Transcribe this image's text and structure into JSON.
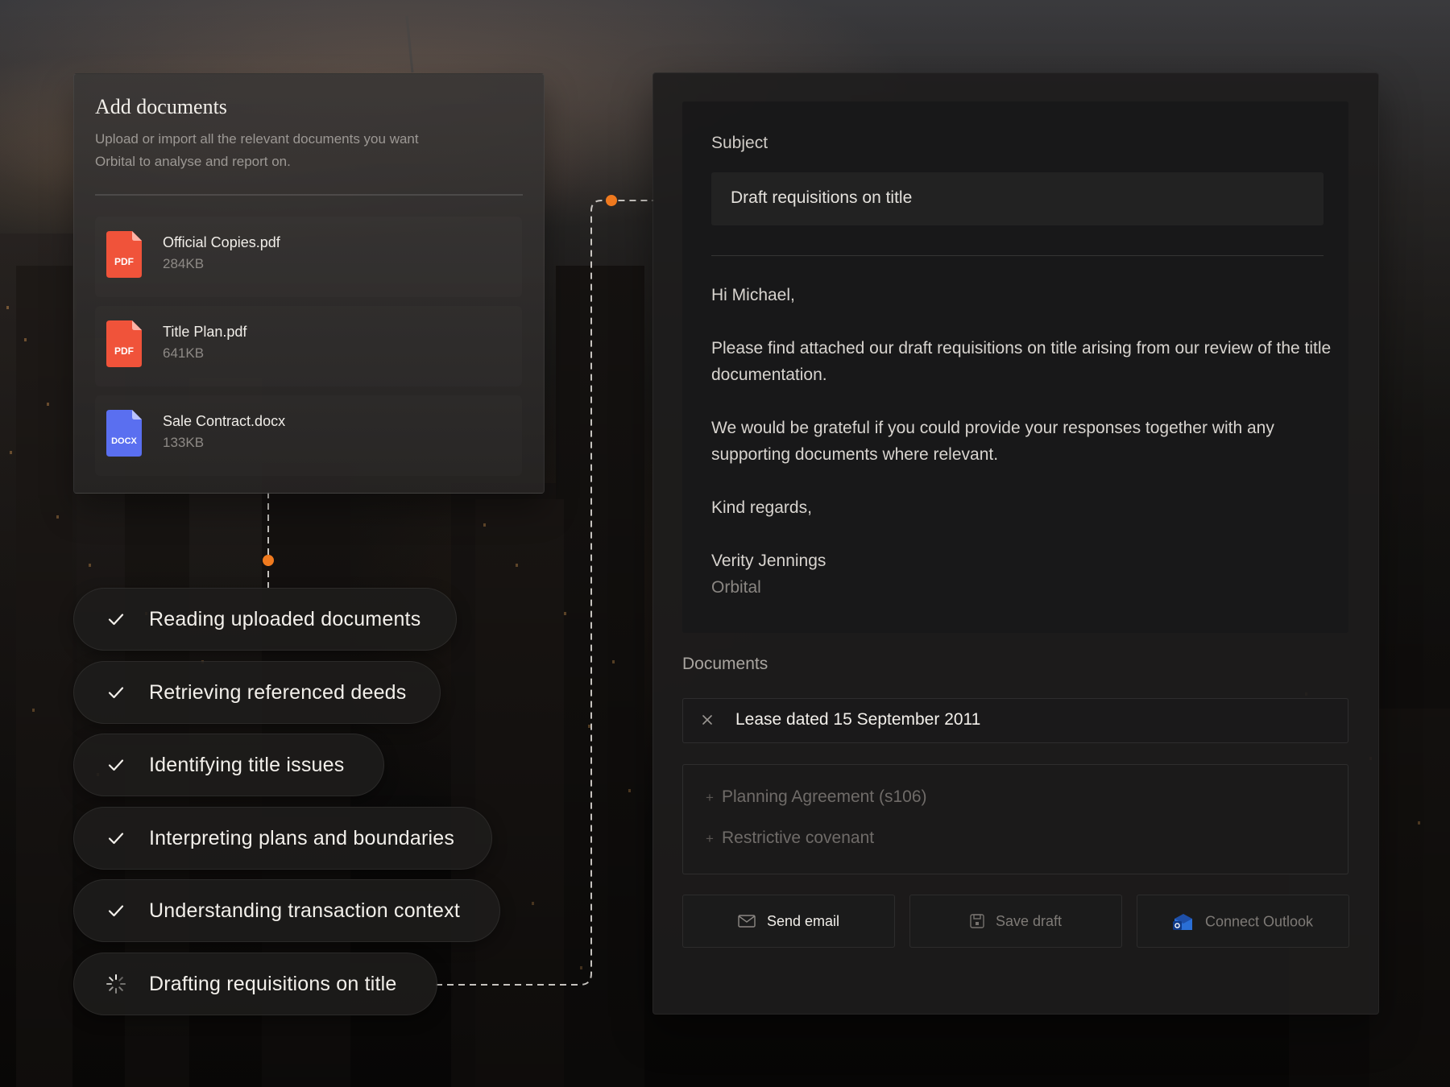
{
  "add_documents": {
    "title": "Add documents",
    "subtitle": "Upload or import all the relevant documents you want Orbital to analyse and report on.",
    "files": [
      {
        "name": "Official Copies.pdf",
        "size": "284KB",
        "type": "PDF",
        "icon": "pdf-file-icon",
        "color": "#f0533a"
      },
      {
        "name": "Title Plan.pdf",
        "size": "641KB",
        "type": "PDF",
        "icon": "pdf-file-icon",
        "color": "#f0533a"
      },
      {
        "name": "Sale Contract.docx",
        "size": "133KB",
        "type": "DOCX",
        "icon": "docx-file-icon",
        "color": "#5a6ff0"
      }
    ]
  },
  "steps": [
    {
      "label": "Reading uploaded documents",
      "status": "done",
      "icon": "check-icon"
    },
    {
      "label": "Retrieving referenced deeds",
      "status": "done",
      "icon": "check-icon"
    },
    {
      "label": "Identifying title issues",
      "status": "done",
      "icon": "check-icon"
    },
    {
      "label": "Interpreting plans and boundaries",
      "status": "done",
      "icon": "check-icon"
    },
    {
      "label": "Understanding transaction context",
      "status": "done",
      "icon": "check-icon"
    },
    {
      "label": "Drafting requisitions on title",
      "status": "in-progress",
      "icon": "spinner-icon"
    }
  ],
  "email": {
    "subject_label": "Subject",
    "subject_value": "Draft requisitions on title",
    "greeting": "Hi Michael,",
    "paragraph1": "Please find attached our draft requisitions on title arising from our review of the title documentation.",
    "paragraph2": "We would be grateful if you could provide your responses together with any supporting documents where relevant.",
    "signoff": "Kind regards,",
    "sender_name": "Verity Jennings",
    "sender_company": "Orbital"
  },
  "documents": {
    "label": "Documents",
    "selected": [
      "Lease dated 15 September 2011"
    ],
    "options": [
      "Planning Agreement (s106)",
      "Restrictive covenant"
    ]
  },
  "actions": {
    "send_email": "Send email",
    "save_draft": "Save draft",
    "connect_outlook": "Connect Outlook"
  },
  "colors": {
    "accent": "#f07a1f",
    "pdf": "#f0533a",
    "docx": "#5a6ff0",
    "outlook": "#2a6fd6"
  }
}
